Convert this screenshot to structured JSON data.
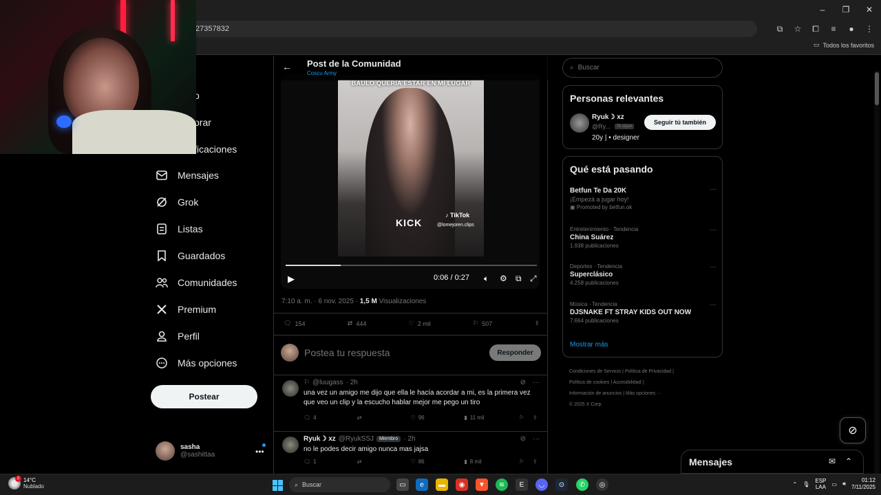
{
  "browser": {
    "url": "27357832",
    "bookmarks_folder": "Todos los favoritos",
    "icons": [
      "cast-icon",
      "star-icon",
      "extensions-icon",
      "menu-icon"
    ]
  },
  "sidebar": {
    "partial_items": [
      "o",
      "orar",
      "ficaciones"
    ],
    "items": [
      {
        "label": "Mensajes",
        "icon": "mail-icon"
      },
      {
        "label": "Grok",
        "icon": "grok-icon"
      },
      {
        "label": "Listas",
        "icon": "list-icon"
      },
      {
        "label": "Guardados",
        "icon": "bookmark-icon"
      },
      {
        "label": "Comunidades",
        "icon": "communities-icon"
      },
      {
        "label": "Premium",
        "icon": "x-icon"
      },
      {
        "label": "Perfil",
        "icon": "profile-icon"
      },
      {
        "label": "Más opciones",
        "icon": "more-icon"
      }
    ],
    "post_button": "Postear",
    "account": {
      "name": "sasha",
      "handle": "@sashittaa"
    }
  },
  "header": {
    "title": "Post de la Comunidad",
    "community": "Coscu Army"
  },
  "video": {
    "caption": "BAULO QUERIA ESTAR EN MI LUGAR",
    "watermark_left": "KICK",
    "watermark_tiktok": "TikTok",
    "watermark_handle": "@lomejoren.clips",
    "time": "0:06 / 0:27",
    "progress": 0.22
  },
  "post_meta": {
    "timestamp": "7:10 a. m. · 6 nov. 2025 · ",
    "views_count": "1,5 M",
    "views_label": " Visualizaciones"
  },
  "actions": {
    "replies": "154",
    "reposts": "444",
    "likes": "2 mil",
    "bookmarks": "507"
  },
  "reply_box": {
    "placeholder": "Postea tu respuesta",
    "button": "Responder"
  },
  "replies": [
    {
      "name": "",
      "handle": "@luugass",
      "time": "· 2h",
      "text": "una vez un amigo me dijo que ella le hacía acordar a mi, es la primera vez que veo un clip y la escucho hablar mejor me pego un tiro",
      "replies": "4",
      "reposts": "",
      "likes": "96",
      "views": "11 mil"
    },
    {
      "name": "Ryuk☽ xz",
      "handle": "@RyukSSJ",
      "badge": "Miembro",
      "time": "· 2h",
      "text": "no le podes decir amigo nunca mas jajsa",
      "replies": "1",
      "reposts": "",
      "likes": "86",
      "views": "8 mil"
    }
  ],
  "right": {
    "search_placeholder": "Buscar",
    "relevant_title": "Personas relevantes",
    "relevant": {
      "name": "Ryuk☽ xz",
      "handle": "@Ry...",
      "follows_you": "Te sigue",
      "bio": "20y | • designer",
      "button": "Seguir tú también"
    },
    "trending_title": "Qué está pasando",
    "trends": [
      {
        "category": "",
        "title": "Betfun Te Da 20K",
        "sub": "¡Empezá a jugar hoy!",
        "count": "Promoted by betfun.ok"
      },
      {
        "category": "Entretenimiento · Tendencia",
        "title": "China Suárez",
        "sub": "",
        "count": "1.938 publicaciones"
      },
      {
        "category": "Deportes · Tendencia",
        "title": "Superclásico",
        "sub": "",
        "count": "4.258 publicaciones"
      },
      {
        "category": "Música · Tendencia",
        "title": "DJSNAKE FT STRAY KIDS OUT NOW",
        "sub": "",
        "count": "7.664 publicaciones"
      }
    ],
    "show_more": "Mostrar más",
    "footer": [
      "Condiciones de Servicio",
      "|",
      "Política de Privacidad",
      "|",
      "Política de cookies",
      "|",
      "Accesibilidad",
      "|",
      "Información de anuncios",
      "|",
      "Más opciones ···",
      "© 2025 X Corp."
    ]
  },
  "messages_drawer": {
    "title": "Mensajes"
  },
  "taskbar": {
    "weather_temp": "14°C",
    "weather_desc": "Nublado",
    "weather_badge": "2",
    "search": "Buscar",
    "lang1": "ESP",
    "lang2": "LAA",
    "time": "01:12",
    "date": "7/11/2025"
  }
}
